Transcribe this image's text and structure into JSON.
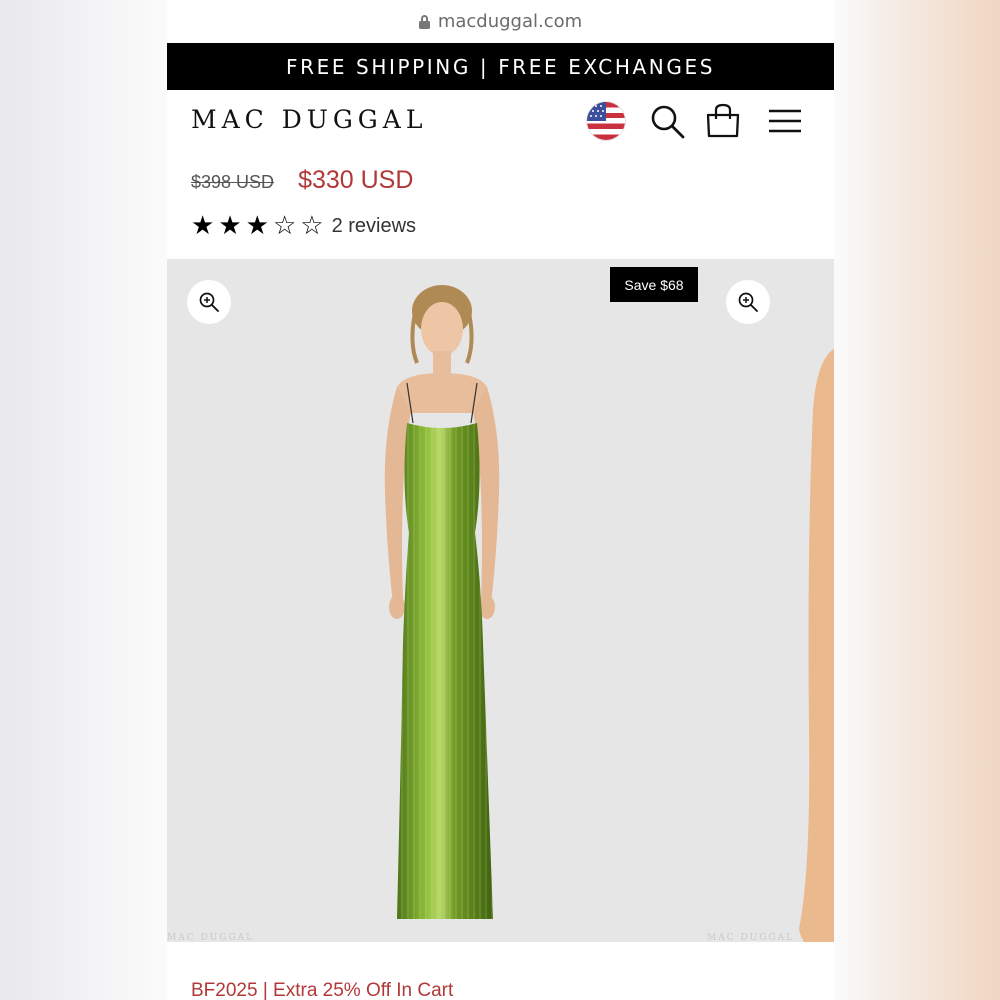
{
  "browser": {
    "url": "macduggal.com",
    "lock_icon": "lock-icon"
  },
  "banner": {
    "text": "FREE SHIPPING | FREE EXCHANGES"
  },
  "header": {
    "logo": "MAC DUGGAL",
    "icons": [
      "us-flag-icon",
      "search-icon",
      "shopping-bag-icon",
      "hamburger-menu-icon"
    ]
  },
  "product": {
    "original_price": "$398 USD",
    "sale_price": "$330 USD",
    "rating": 3,
    "rating_max": 5,
    "reviews_label": "2 reviews",
    "save_badge": "Save $68",
    "watermark": "MAC DUGGAL",
    "promo": "BF2025 | Extra 25% Off In Cart"
  },
  "colors": {
    "banner_bg": "#000000",
    "sale_price": "#b23838",
    "gallery_bg": "#e6e6e6",
    "dress": "#6f9a24"
  }
}
